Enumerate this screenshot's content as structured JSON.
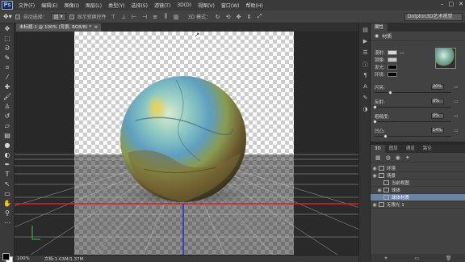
{
  "menubar": {
    "logo": "Ps",
    "items": [
      "文件(F)",
      "编辑(E)",
      "图像(I)",
      "图层(L)",
      "类型(Y)",
      "选择(S)",
      "滤镜(T)",
      "3D(D)",
      "视图(V)",
      "窗口(W)",
      "帮助(H)"
    ],
    "window_controls": [
      "–",
      "□",
      "✕"
    ]
  },
  "options": {
    "tool_icon": "move-tool-icon",
    "auto_select_label": "自动选择：",
    "auto_select_value": "组",
    "show_transform_label": "显示变换控件",
    "mode_label": "3D 模式：",
    "workspace": "Dolphin3D艺术视觉"
  },
  "document": {
    "tab_title": "未标题-1 @ 100% (背景, RGB/8) *",
    "zoom": "100%",
    "doc_size": "文档:1.03M/1.37M"
  },
  "properties": {
    "tabs": [
      "属性"
    ],
    "head_label": "材质",
    "materials": [
      {
        "label": "漫射:",
        "color": "#d8d8d8"
      },
      {
        "label": "镜像:",
        "color": "#c8c8c8"
      },
      {
        "label": "发光:",
        "color": "#000000"
      },
      {
        "label": "环境:",
        "color": "#000000"
      }
    ],
    "sliders": [
      {
        "label": "闪亮:",
        "value": "20%",
        "fraction": 0.2
      },
      {
        "label": "反射:",
        "value": "0%",
        "fraction": 0.0
      },
      {
        "label": "粗糙度:",
        "value": "0%",
        "fraction": 0.0
      },
      {
        "label": "凹凸:",
        "value": "14%",
        "fraction": 0.14
      }
    ]
  },
  "panel3d": {
    "tabs": [
      "3D",
      "图层",
      "通道",
      "路径"
    ],
    "rows": [
      {
        "label": "环境",
        "selected": false
      },
      {
        "label": "场景",
        "selected": false
      },
      {
        "label": "当前视图",
        "selected": false
      },
      {
        "label": "球体",
        "selected": false
      },
      {
        "label": "球体材质",
        "selected": true
      },
      {
        "label": "无限光 1",
        "selected": false
      }
    ]
  },
  "colors": {
    "ground_line": "#e02020",
    "axis_line": "#1e2fd8",
    "selection_blue": "#6b84a6"
  }
}
